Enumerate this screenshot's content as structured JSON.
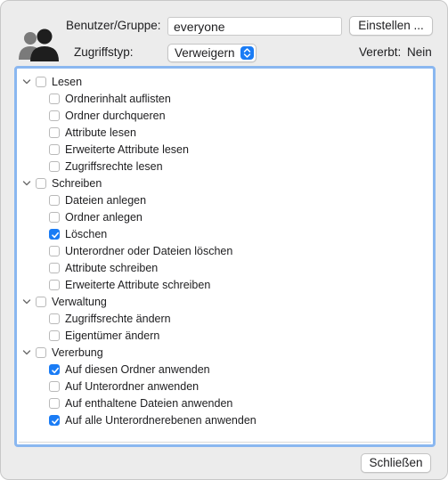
{
  "header": {
    "user_label": "Benutzer/Gruppe:",
    "user_value": "everyone",
    "settings_button": "Einstellen ...",
    "access_type_label": "Zugriffstyp:",
    "access_type_value": "Verweigern",
    "inherited_label": "Vererbt:",
    "inherited_value": "Nein"
  },
  "groups": [
    {
      "label": "Lesen",
      "checked": false,
      "items": [
        {
          "label": "Ordnerinhalt auflisten",
          "checked": false
        },
        {
          "label": "Ordner durchqueren",
          "checked": false
        },
        {
          "label": "Attribute lesen",
          "checked": false
        },
        {
          "label": "Erweiterte Attribute lesen",
          "checked": false
        },
        {
          "label": "Zugriffsrechte lesen",
          "checked": false
        }
      ]
    },
    {
      "label": "Schreiben",
      "checked": false,
      "items": [
        {
          "label": "Dateien anlegen",
          "checked": false
        },
        {
          "label": "Ordner anlegen",
          "checked": false
        },
        {
          "label": "Löschen",
          "checked": true
        },
        {
          "label": "Unterordner oder Dateien löschen",
          "checked": false
        },
        {
          "label": "Attribute schreiben",
          "checked": false
        },
        {
          "label": "Erweiterte Attribute schreiben",
          "checked": false
        }
      ]
    },
    {
      "label": "Verwaltung",
      "checked": false,
      "items": [
        {
          "label": "Zugriffsrechte ändern",
          "checked": false
        },
        {
          "label": "Eigentümer ändern",
          "checked": false
        }
      ]
    },
    {
      "label": "Vererbung",
      "checked": false,
      "items": [
        {
          "label": "Auf diesen Ordner anwenden",
          "checked": true
        },
        {
          "label": "Auf Unterordner anwenden",
          "checked": false
        },
        {
          "label": "Auf enthaltene Dateien anwenden",
          "checked": false
        },
        {
          "label": "Auf alle Unterordnerebenen anwenden",
          "checked": true
        }
      ]
    }
  ],
  "footer": {
    "close_button": "Schließen"
  },
  "colors": {
    "accent": "#1a7cf5",
    "focus_ring": "#8ab7f0"
  }
}
